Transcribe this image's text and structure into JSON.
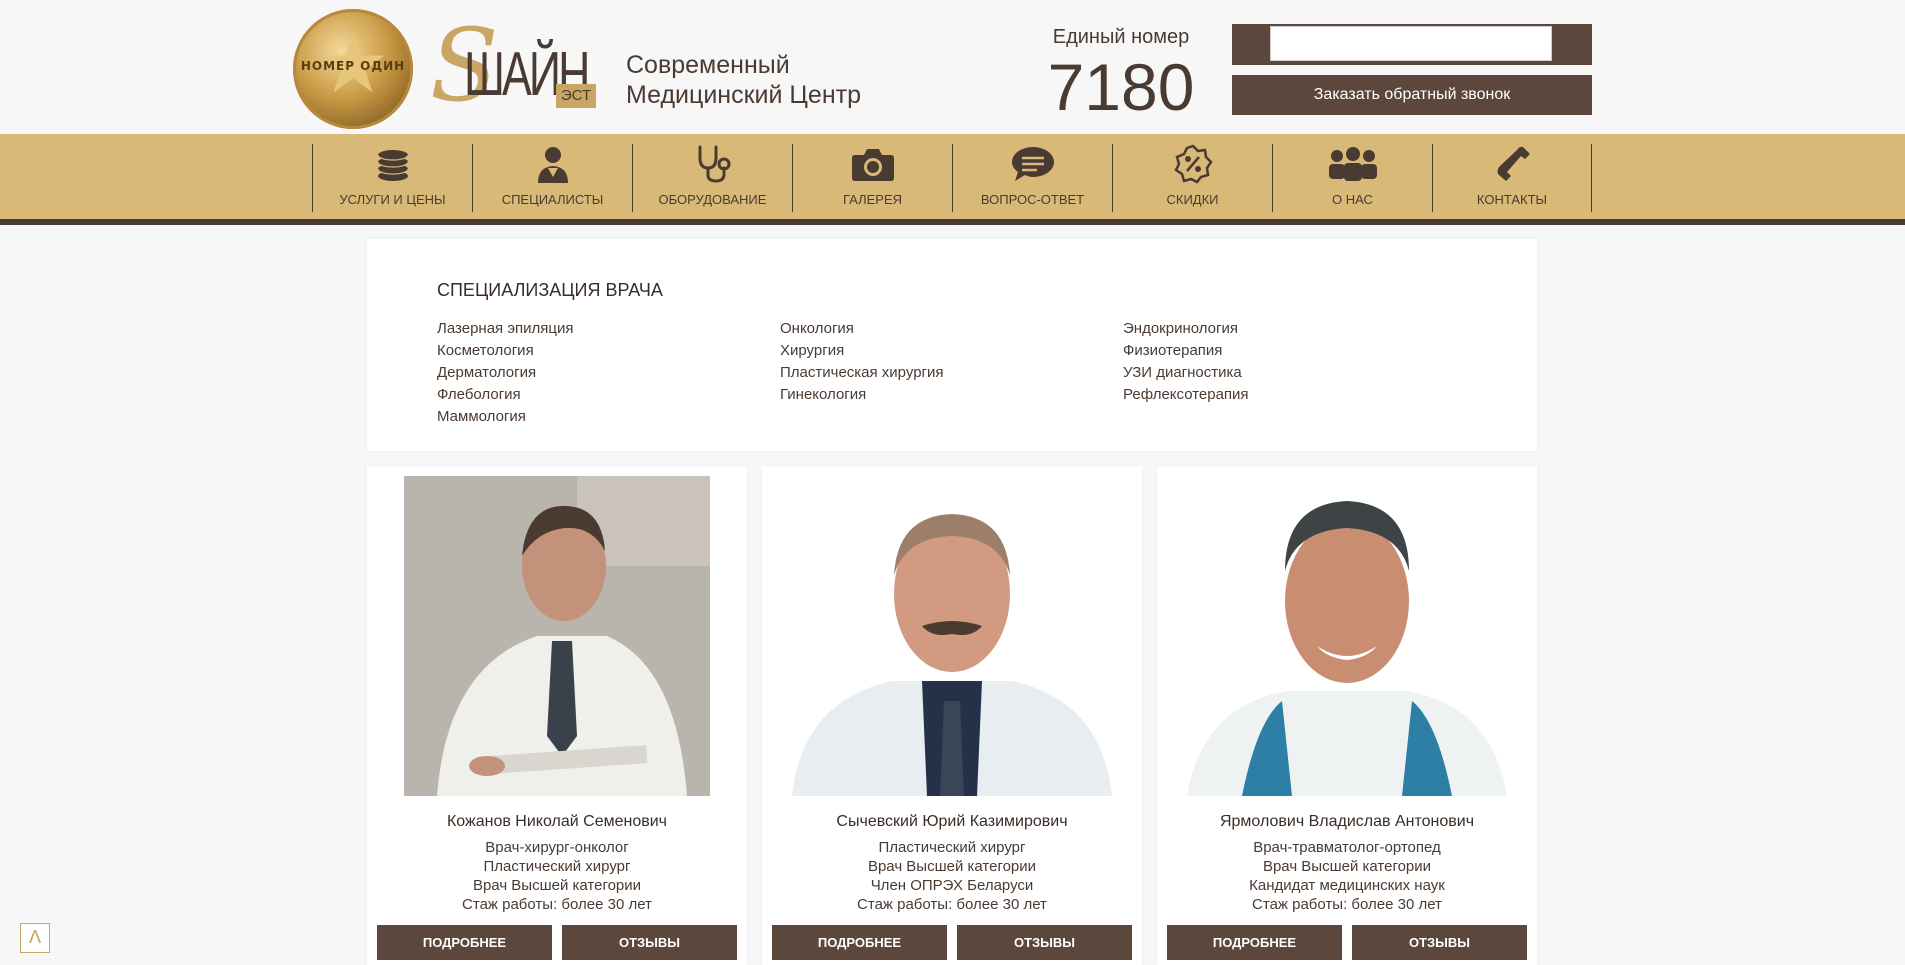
{
  "header": {
    "medal_text": "НОМЕР ОДИН",
    "logo_word": "ШАЙН",
    "logo_suffix": "ЭСТ",
    "tagline_line1": "Современный",
    "tagline_line2": "Медицинский Центр",
    "phone_label": "Единый номер",
    "phone_number": "7180",
    "search_placeholder": "",
    "callback_label": "Заказать обратный звонок"
  },
  "nav": {
    "items": [
      {
        "label": "УСЛУГИ И ЦЕНЫ",
        "icon": "coins-icon"
      },
      {
        "label": "СПЕЦИАЛИСТЫ",
        "icon": "doctor-icon"
      },
      {
        "label": "ОБОРУДОВАНИЕ",
        "icon": "stethoscope-icon"
      },
      {
        "label": "ГАЛЕРЕЯ",
        "icon": "camera-icon"
      },
      {
        "label": "ВОПРОС-ОТВЕТ",
        "icon": "chat-icon"
      },
      {
        "label": "СКИДКИ",
        "icon": "discount-icon"
      },
      {
        "label": "О НАС",
        "icon": "people-icon"
      },
      {
        "label": "КОНТАКТЫ",
        "icon": "phone-icon"
      }
    ]
  },
  "specialization": {
    "title": "СПЕЦИАЛИЗАЦИЯ ВРАЧА",
    "col1": [
      "Лазерная эпиляция",
      "Косметология",
      "Дерматология",
      "Флебология",
      "Маммология"
    ],
    "col2": [
      "Онкология",
      "Хирургия",
      "Пластическая хирургия",
      "Гинекология"
    ],
    "col3": [
      "Эндокринология",
      "Физиотерапия",
      "УЗИ диагностика",
      "Рефлексотерапия"
    ]
  },
  "doctors": [
    {
      "name": "Кожанов Николай Семенович",
      "lines": [
        "Врач-хирург-онколог",
        "Пластический хирург",
        "Врач Высшей категории",
        "Стаж работы: более 30 лет"
      ],
      "more": "ПОДРОБНЕЕ",
      "reviews": "ОТЗЫВЫ"
    },
    {
      "name": "Сычевский Юрий Казимирович",
      "lines": [
        "Пластический хирург",
        "Врач Высшей категории",
        "Член ОПРЭХ Беларуси",
        "Стаж работы: более 30 лет"
      ],
      "more": "ПОДРОБНЕЕ",
      "reviews": "ОТЗЫВЫ"
    },
    {
      "name": "Ярмолович Владислав Антонович",
      "lines": [
        "Врач-травматолог-ортопед",
        "Врач Высшей категории",
        "Кандидат медицинских наук",
        "Стаж работы: более 30 лет"
      ],
      "more": "ПОДРОБНЕЕ",
      "reviews": "ОТЗЫВЫ"
    }
  ],
  "scroll_top_symbol": "Λ",
  "colors": {
    "brown": "#5b473c",
    "gold": "#d9b978",
    "text": "#4a3b32"
  }
}
